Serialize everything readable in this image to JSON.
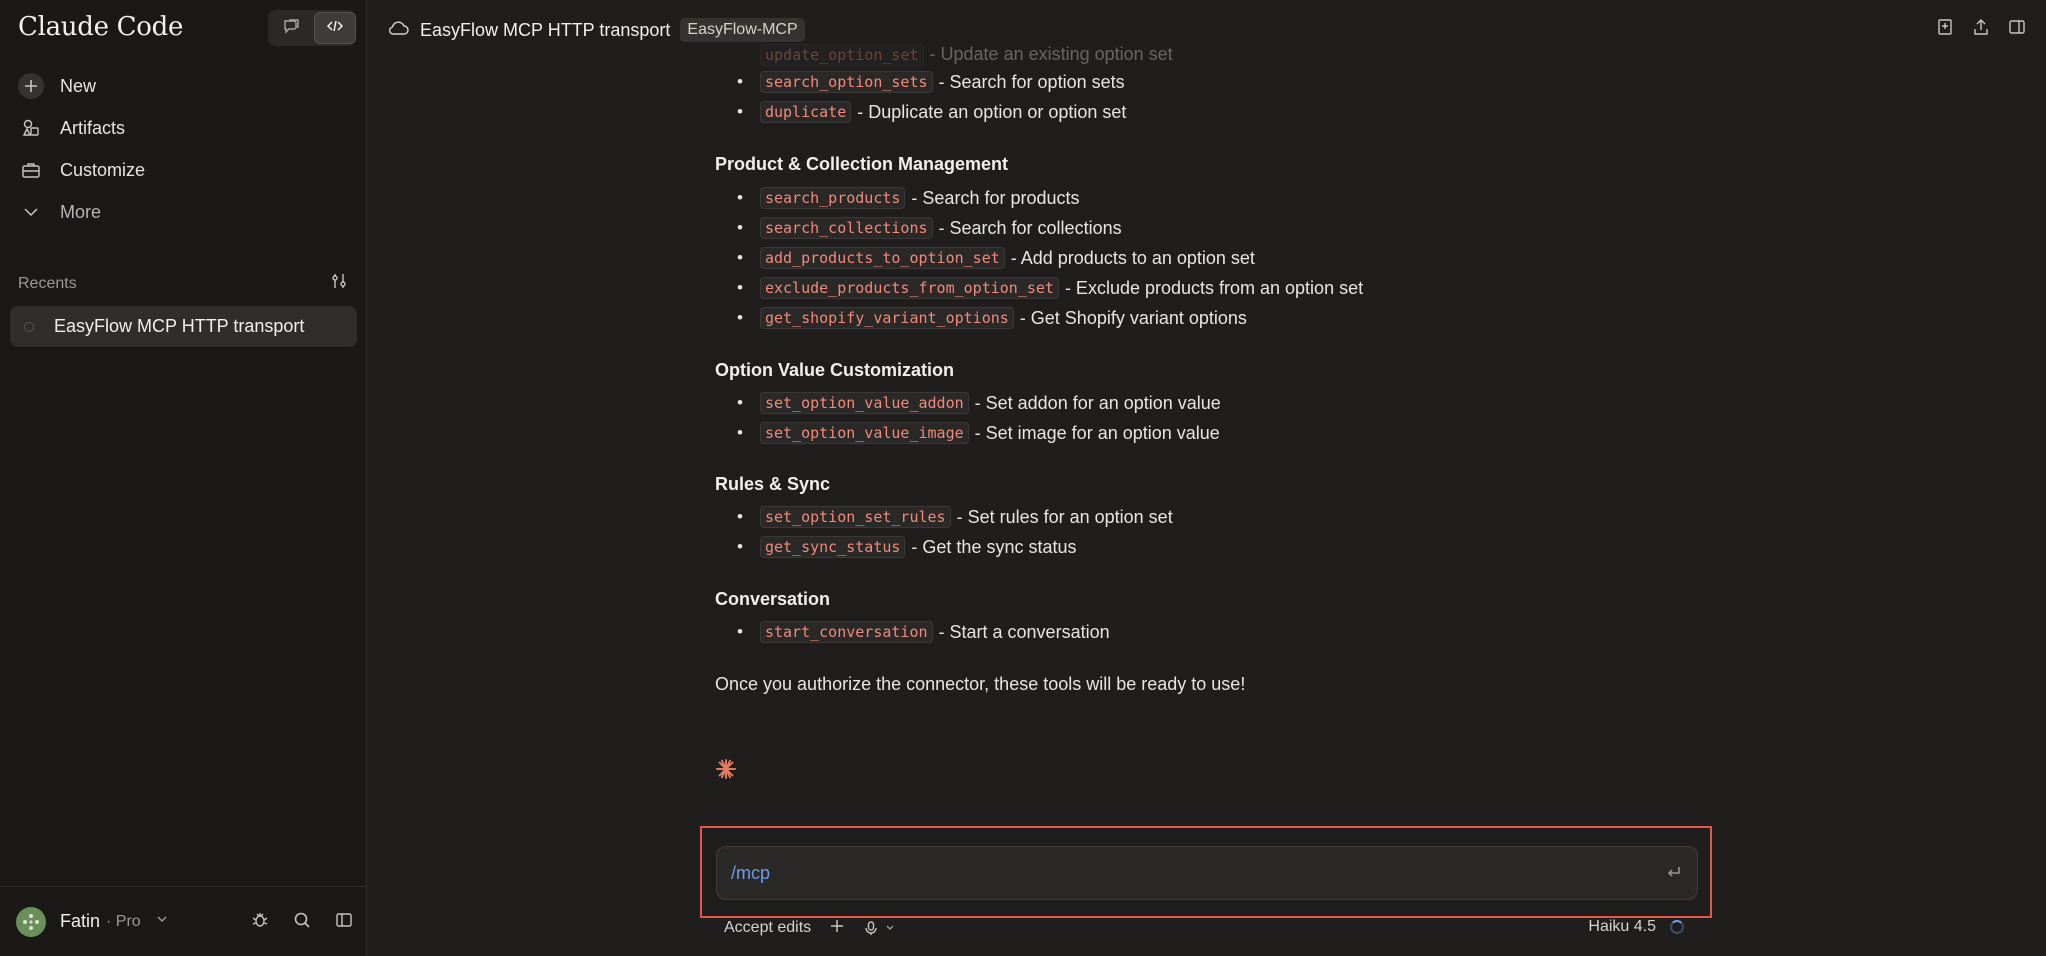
{
  "app": {
    "brand": "Claude Code",
    "modes": [
      {
        "name": "chat",
        "icon": "chat-bubble-icon"
      },
      {
        "name": "code",
        "icon": "code-icon"
      }
    ]
  },
  "sidebar": {
    "nav": [
      {
        "label": "New",
        "icon": "plus-icon"
      },
      {
        "label": "Artifacts",
        "icon": "shapes-icon"
      },
      {
        "label": "Customize",
        "icon": "briefcase-icon"
      },
      {
        "label": "More",
        "icon": "chevron-down-icon"
      }
    ],
    "recents_label": "Recents",
    "recents": [
      {
        "label": "EasyFlow MCP HTTP transport"
      }
    ],
    "user": {
      "name": "Fatin",
      "plan": "· Pro"
    }
  },
  "header": {
    "title": "EasyFlow MCP HTTP transport",
    "badge": "EasyFlow-MCP"
  },
  "content": {
    "faded": {
      "code": "update_option_set",
      "desc": "- Update an existing option set"
    },
    "top_items": [
      {
        "code": "search_option_sets",
        "desc": "- Search for option sets"
      },
      {
        "code": "duplicate",
        "desc": "- Duplicate an option or option set"
      }
    ],
    "sections": [
      {
        "title": "Product & Collection Management",
        "items": [
          {
            "code": "search_products",
            "desc": "- Search for products"
          },
          {
            "code": "search_collections",
            "desc": "- Search for collections"
          },
          {
            "code": "add_products_to_option_set",
            "desc": "- Add products to an option set"
          },
          {
            "code": "exclude_products_from_option_set",
            "desc": "- Exclude products from an option set"
          },
          {
            "code": "get_shopify_variant_options",
            "desc": "- Get Shopify variant options"
          }
        ]
      },
      {
        "title": "Option Value Customization",
        "items": [
          {
            "code": "set_option_value_addon",
            "desc": "- Set addon for an option value"
          },
          {
            "code": "set_option_value_image",
            "desc": "- Set image for an option value"
          }
        ]
      },
      {
        "title": "Rules & Sync",
        "items": [
          {
            "code": "set_option_set_rules",
            "desc": "- Set rules for an option set"
          },
          {
            "code": "get_sync_status",
            "desc": "- Get the sync status"
          }
        ]
      },
      {
        "title": "Conversation",
        "items": [
          {
            "code": "start_conversation",
            "desc": "- Start a conversation"
          }
        ]
      }
    ],
    "closing": "Once you authorize the connector, these tools will be ready to use!"
  },
  "composer": {
    "value": "/mcp",
    "accept_label": "Accept edits",
    "model": "Haiku 4.5"
  },
  "colors": {
    "accent": "#e3574a",
    "code_text": "#f08a7a",
    "command": "#6d9be8"
  }
}
